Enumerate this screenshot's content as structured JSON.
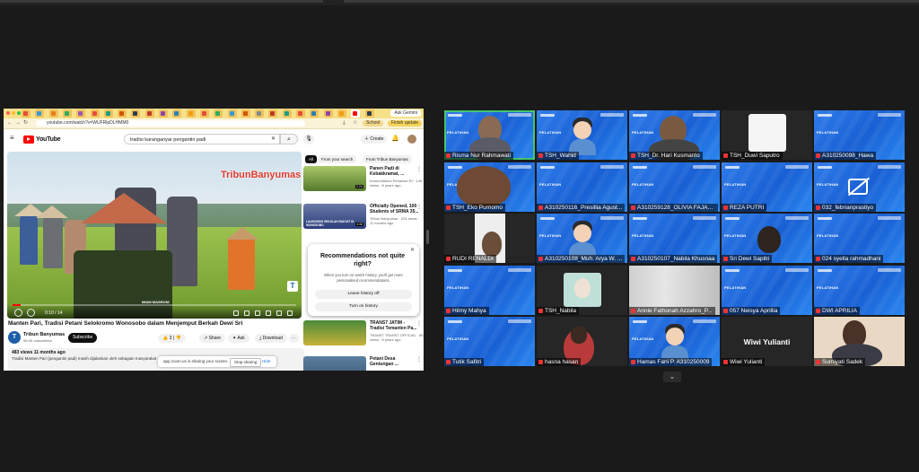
{
  "browser": {
    "ask_label": "Ask Gemini",
    "url": "youtube.com/watch?v=WUFRlpDLHMM0",
    "profile_pill": "School",
    "update_pill": "Finish update",
    "nav_icons": [
      "back-icon",
      "forward-icon",
      "reload-icon"
    ]
  },
  "youtube": {
    "logo_text": "YouTube",
    "search_query": "tradisi karanganyar pengantin padi",
    "create_label": "Create",
    "video": {
      "watermark": "TribunBanyumas",
      "watermark_alt": "Tribun",
      "overlay_text": "IMAM MASRONI",
      "time": "0:10 / 14",
      "progress": 0.03,
      "title": "Manten Pari, Tradisi Petani Selokromo Wonosobo dalam Menjemput Berkah Dewi Sri",
      "channel": "Tribun Banyumas",
      "channel_initial": "T",
      "subscribers": "56.9K subscribers",
      "subscribe_label": "Subscribe",
      "likes": "3",
      "share_label": "Share",
      "ask_label": "Ask",
      "download_label": "Download",
      "views": "483 views  11 months ago",
      "description": "Tradisi Manten Pari (pengantin padi) masih dijalankan oleh sebagian masyarakat"
    },
    "chips": [
      "All",
      "From your search",
      "From Tribun Banyumas"
    ],
    "recommendations": [
      {
        "title": "Panen Padi di Kebakkramat, ...",
        "meta": "Kemendikbud Pertanian RI · 14K views · 8 years ago",
        "dur": "2:24"
      },
      {
        "title": "Officially Opened, 100 Students of SRMA 35...",
        "meta": "Tribun Banyumas · 224 views · 11 months ago",
        "dur": "4:46",
        "thumb_text": "LAUNCHING SEKOLAH RAKYAT DI WONOSOBO"
      },
      {
        "title": "TRANS7 JATIM - Tradisi Temanten Pa...",
        "meta": "TRANS7 TRANS7 OFFICIAL · 8K views · 8 years ago",
        "dur": ""
      },
      {
        "title": "Petani Desa Gentungan ...",
        "meta": "",
        "dur": ""
      }
    ],
    "popup": {
      "title": "Recommendations not quite right?",
      "desc": "When you turn on watch history, you'll get more personalised recommendations.",
      "btn1": "Leave history off",
      "btn2": "Turn on history"
    },
    "share_bar": {
      "text": "app.zoom.us is sharing your screen.",
      "stop": "Stop sharing",
      "hide": "Hide"
    }
  },
  "gallery": {
    "pelatihan_label": "PELATIHAN",
    "participants": [
      "Risma Nur Rahmawati",
      "TSH_Wahid",
      "TSH_Dr. Hari Kusmanto",
      "TSH_Duwi Saputro",
      "A310250098_Hawa",
      "TSH_Eko Purnomo",
      "A310250116_Presillia Agust...",
      "A310259128_OLIVIA FAJAR ...",
      "REZA PUTRI",
      "032_febrianprastiyo",
      "RUDI RENALDI",
      "A310250108_Muh. Arya W. ...",
      "A310250107_Nabila Khusnaa",
      "Sri Dewi Sapitri",
      "024 syella rahmadhani",
      "Hilmy Mahya",
      "TSH_Nabila",
      "Annie Fathonah Azzahro_P...",
      "057 Neisya Aprillia",
      "DWI APRILIA",
      "Tutik Safitri",
      "hasna hasan",
      "Hamas Fani P. A310250009",
      "Wiwi Yulianti",
      "Sumiyati Sadek"
    ],
    "name_card": "Wiwi Yulianti",
    "speaker_index": 0,
    "colors": {
      "tile_blue": "#1f6fe0",
      "speaker_outline": "#3ec46d"
    }
  }
}
